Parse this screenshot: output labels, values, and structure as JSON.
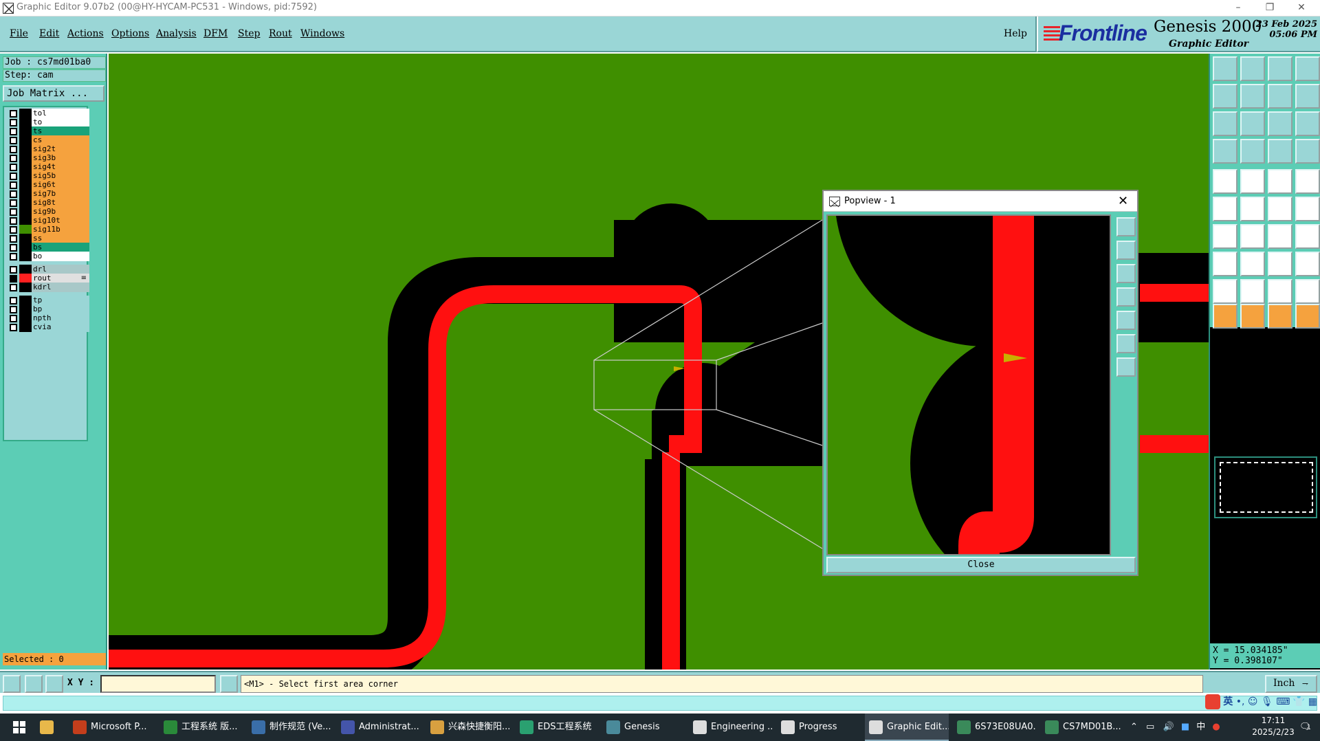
{
  "window": {
    "title": "Graphic Editor 9.07b2 (00@HY-HYCAM-PC531 - Windows, pid:7592)",
    "minimize": "–",
    "restore": "❐",
    "close": "✕"
  },
  "menubar": {
    "items": [
      "File",
      "Edit",
      "Actions",
      "Options",
      "Analysis",
      "DFM",
      "Step",
      "Rout",
      "Windows"
    ],
    "help": "Help"
  },
  "brand": {
    "logo": "Frontline",
    "product": "Genesis 2000",
    "subtitle": "Graphic Editor",
    "date": "23 Feb 2025",
    "time": "05:06 PM"
  },
  "left_panel": {
    "job": "Job  : cs7md01ba0",
    "step": "Step: cam",
    "job_matrix": "Job Matrix ...",
    "selected": "Selected : 0",
    "layers": [
      {
        "name": "tol",
        "color": "#ffffff",
        "swatch": "#000000"
      },
      {
        "name": "to",
        "color": "#ffffff",
        "swatch": "#000000"
      },
      {
        "name": "ts",
        "color": "#1aa37a",
        "swatch": "#000000"
      },
      {
        "name": "cs",
        "color": "#f5a23e",
        "swatch": "#000000"
      },
      {
        "name": "sig2t",
        "color": "#f5a23e",
        "swatch": "#000000"
      },
      {
        "name": "sig3b",
        "color": "#f5a23e",
        "swatch": "#000000"
      },
      {
        "name": "sig4t",
        "color": "#f5a23e",
        "swatch": "#000000"
      },
      {
        "name": "sig5b",
        "color": "#f5a23e",
        "swatch": "#000000"
      },
      {
        "name": "sig6t",
        "color": "#f5a23e",
        "swatch": "#000000"
      },
      {
        "name": "sig7b",
        "color": "#f5a23e",
        "swatch": "#000000"
      },
      {
        "name": "sig8t",
        "color": "#f5a23e",
        "swatch": "#000000"
      },
      {
        "name": "sig9b",
        "color": "#f5a23e",
        "swatch": "#000000"
      },
      {
        "name": "sig10t",
        "color": "#f5a23e",
        "swatch": "#000000"
      },
      {
        "name": "sig11b",
        "color": "#f5a23e",
        "swatch": "#3f8f00"
      },
      {
        "name": "ss",
        "color": "#f5a23e",
        "swatch": "#000000"
      },
      {
        "name": "bs",
        "color": "#1aa37a",
        "swatch": "#000000"
      },
      {
        "name": "bo",
        "color": "#ffffff",
        "swatch": "#000000"
      },
      {
        "name": "drl",
        "color": "#a8c8c8",
        "swatch": "#000000"
      },
      {
        "name": "rout",
        "color": "#e0e0e0",
        "swatch": "#ff2020",
        "flag": "≡"
      },
      {
        "name": "kdrl",
        "color": "#a8c8c8",
        "swatch": "#000000"
      },
      {
        "name": "tp",
        "color": "#9ad6d6",
        "swatch": "#000000"
      },
      {
        "name": "bp",
        "color": "#9ad6d6",
        "swatch": "#000000"
      },
      {
        "name": "npth",
        "color": "#9ad6d6",
        "swatch": "#000000"
      },
      {
        "name": "cvia",
        "color": "#9ad6d6",
        "swatch": "#000000"
      }
    ]
  },
  "colors": {
    "board_green": "#3f8f00",
    "copper_black": "#000000",
    "rout_red": "#ff1010",
    "panel_teal": "#5ccdb5",
    "menu_cyan": "#9ad6d6"
  },
  "popview": {
    "title": "Popview - 1",
    "close_label": "Close",
    "close_x": "✕"
  },
  "toolbox": {
    "coord_x": "X = 15.034185\"",
    "coord_y": "Y = 0.398107\""
  },
  "command": {
    "xy_label": "X Y :",
    "xy_value": "",
    "message": "<M1> - Select first area corner",
    "unit": "Inch"
  },
  "ime": {
    "lang": "英"
  },
  "taskbar": {
    "items": [
      {
        "label": "Microsoft P...",
        "icon": "#c43e1c"
      },
      {
        "label": "工程系统   版...",
        "icon": "#2a8a3a"
      },
      {
        "label": "制作规范 (Ve...",
        "icon": "#3a6ea8"
      },
      {
        "label": "Administrat...",
        "icon": "#4455aa"
      },
      {
        "label": "兴森快捷衡阳...",
        "icon": "#d8a040"
      },
      {
        "label": "EDS工程系统",
        "icon": "#2aa070"
      },
      {
        "label": "Genesis",
        "icon": "#4a8a9a"
      },
      {
        "label": "Engineering ...",
        "icon": "#dddddd"
      },
      {
        "label": "Progress",
        "icon": "#dddddd"
      },
      {
        "label": "Graphic Edit...",
        "icon": "#dddddd"
      },
      {
        "label": "6S73E08UA0...",
        "icon": "#3a8a5a"
      },
      {
        "label": "CS7MD01B...",
        "icon": "#3a8a5a"
      }
    ],
    "time": "17:11",
    "date": "2025/2/23",
    "input_lang": "中",
    "notif_count": "1"
  }
}
